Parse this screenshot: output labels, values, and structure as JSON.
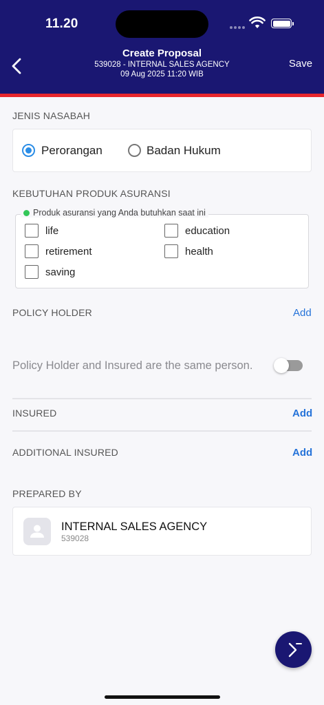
{
  "status_bar": {
    "time": "11.20"
  },
  "header": {
    "title": "Create Proposal",
    "subtitle_agency": "539028 - INTERNAL SALES AGENCY",
    "subtitle_datetime": "09 Aug 2025 11:20 WIB",
    "save_label": "Save"
  },
  "jenis_nasabah": {
    "label": "JENIS NASABAH",
    "options": [
      {
        "label": "Perorangan",
        "selected": true
      },
      {
        "label": "Badan Hukum",
        "selected": false
      }
    ]
  },
  "kebutuhan": {
    "label": "KEBUTUHAN PRODUK ASURANSI",
    "legend": "Produk asuransi yang Anda butuhkan saat ini",
    "options": [
      {
        "label": "life",
        "checked": false
      },
      {
        "label": "education",
        "checked": false
      },
      {
        "label": "retirement",
        "checked": false
      },
      {
        "label": "health",
        "checked": false
      },
      {
        "label": "saving",
        "checked": false
      }
    ]
  },
  "policy_holder": {
    "label": "POLICY HOLDER",
    "add_label": "Add"
  },
  "same_person": {
    "label": "Policy Holder and Insured are the same person.",
    "enabled": false
  },
  "insured": {
    "label": "INSURED",
    "add_label": "Add"
  },
  "additional_insured": {
    "label": "ADDITIONAL INSURED",
    "add_label": "Add"
  },
  "prepared_by": {
    "label": "PREPARED BY",
    "name": "INTERNAL SALES AGENCY",
    "code": "539028"
  },
  "colors": {
    "header_bg": "#1a1772",
    "accent_red": "#e8262c",
    "link_blue": "#2573d9",
    "radio_blue": "#2b8de6",
    "legend_green": "#34c759"
  }
}
